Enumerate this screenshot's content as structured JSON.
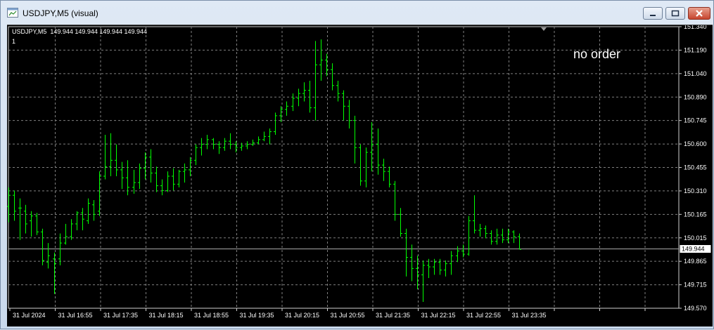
{
  "window": {
    "title": "USDJPY,M5 (visual)",
    "buttons": {
      "minimize_icon": "minimize-icon",
      "maximize_icon": "restore-icon",
      "close_icon": "close-icon"
    }
  },
  "chart_header": {
    "symbol_line": "USDJPY,M5  149.944 149.944 149.944 149.944",
    "sub_line": "1",
    "status_text": "no order"
  },
  "colors": {
    "background": "#000000",
    "grid": "#7f7f7f",
    "bars": "#00ff00",
    "text": "#ffffff",
    "price_line": "#c0c0c0"
  },
  "chart_data": {
    "type": "bar",
    "grid": true,
    "ylim": [
      149.57,
      151.34
    ],
    "y_ticks": [
      "151.340",
      "151.190",
      "151.040",
      "150.890",
      "150.745",
      "150.600",
      "150.455",
      "150.310",
      "150.165",
      "150.015",
      "149.865",
      "149.715",
      "149.570"
    ],
    "x_ticks": [
      "31 Jul 2024",
      "31 Jul 16:55",
      "31 Jul 17:35",
      "31 Jul 18:15",
      "31 Jul 18:55",
      "31 Jul 19:35",
      "31 Jul 20:15",
      "31 Jul 20:55",
      "31 Jul 21:35",
      "31 Jul 22:15",
      "31 Jul 22:55",
      "31 Jul 23:35"
    ],
    "current_price": "149.944",
    "bars": [
      {
        "o": 150.21,
        "h": 150.33,
        "l": 150.11,
        "c": 150.28
      },
      {
        "o": 150.28,
        "h": 150.31,
        "l": 150.12,
        "c": 150.18
      },
      {
        "o": 150.2,
        "h": 150.26,
        "l": 150.0,
        "c": 150.2
      },
      {
        "o": 150.18,
        "h": 150.22,
        "l": 150.04,
        "c": 150.1
      },
      {
        "o": 150.12,
        "h": 150.18,
        "l": 150.02,
        "c": 150.15
      },
      {
        "o": 150.15,
        "h": 150.17,
        "l": 150.03,
        "c": 150.05
      },
      {
        "o": 150.05,
        "h": 150.07,
        "l": 149.84,
        "c": 149.87
      },
      {
        "o": 149.86,
        "h": 149.98,
        "l": 149.82,
        "c": 149.9
      },
      {
        "o": 149.88,
        "h": 149.92,
        "l": 149.66,
        "c": 149.85
      },
      {
        "o": 149.88,
        "h": 150.04,
        "l": 149.84,
        "c": 149.98
      },
      {
        "o": 149.98,
        "h": 150.1,
        "l": 149.97,
        "c": 150.02
      },
      {
        "o": 150.02,
        "h": 150.13,
        "l": 150.0,
        "c": 150.1
      },
      {
        "o": 150.1,
        "h": 150.18,
        "l": 150.06,
        "c": 150.17
      },
      {
        "o": 150.17,
        "h": 150.2,
        "l": 150.06,
        "c": 150.13
      },
      {
        "o": 150.12,
        "h": 150.26,
        "l": 150.1,
        "c": 150.23
      },
      {
        "o": 150.22,
        "h": 150.25,
        "l": 150.12,
        "c": 150.16
      },
      {
        "o": 150.18,
        "h": 150.43,
        "l": 150.15,
        "c": 150.4
      },
      {
        "o": 150.4,
        "h": 150.66,
        "l": 150.38,
        "c": 150.46
      },
      {
        "o": 150.46,
        "h": 150.67,
        "l": 150.4,
        "c": 150.5
      },
      {
        "o": 150.5,
        "h": 150.6,
        "l": 150.4,
        "c": 150.44
      },
      {
        "o": 150.44,
        "h": 150.49,
        "l": 150.32,
        "c": 150.39
      },
      {
        "o": 150.39,
        "h": 150.5,
        "l": 150.28,
        "c": 150.33
      },
      {
        "o": 150.33,
        "h": 150.44,
        "l": 150.29,
        "c": 150.36
      },
      {
        "o": 150.36,
        "h": 150.48,
        "l": 150.32,
        "c": 150.45
      },
      {
        "o": 150.45,
        "h": 150.55,
        "l": 150.38,
        "c": 150.52
      },
      {
        "o": 150.52,
        "h": 150.57,
        "l": 150.36,
        "c": 150.42
      },
      {
        "o": 150.42,
        "h": 150.46,
        "l": 150.3,
        "c": 150.34
      },
      {
        "o": 150.34,
        "h": 150.38,
        "l": 150.28,
        "c": 150.31
      },
      {
        "o": 150.31,
        "h": 150.43,
        "l": 150.3,
        "c": 150.4
      },
      {
        "o": 150.4,
        "h": 150.45,
        "l": 150.31,
        "c": 150.35
      },
      {
        "o": 150.35,
        "h": 150.44,
        "l": 150.33,
        "c": 150.43
      },
      {
        "o": 150.43,
        "h": 150.48,
        "l": 150.36,
        "c": 150.44
      },
      {
        "o": 150.44,
        "h": 150.52,
        "l": 150.4,
        "c": 150.5
      },
      {
        "o": 150.5,
        "h": 150.6,
        "l": 150.47,
        "c": 150.58
      },
      {
        "o": 150.58,
        "h": 150.64,
        "l": 150.53,
        "c": 150.6
      },
      {
        "o": 150.6,
        "h": 150.66,
        "l": 150.57,
        "c": 150.63
      },
      {
        "o": 150.63,
        "h": 150.64,
        "l": 150.57,
        "c": 150.6
      },
      {
        "o": 150.6,
        "h": 150.62,
        "l": 150.54,
        "c": 150.58
      },
      {
        "o": 150.58,
        "h": 150.64,
        "l": 150.56,
        "c": 150.62
      },
      {
        "o": 150.62,
        "h": 150.67,
        "l": 150.57,
        "c": 150.6
      },
      {
        "o": 150.6,
        "h": 150.62,
        "l": 150.55,
        "c": 150.58
      },
      {
        "o": 150.58,
        "h": 150.61,
        "l": 150.56,
        "c": 150.59
      },
      {
        "o": 150.59,
        "h": 150.62,
        "l": 150.57,
        "c": 150.6
      },
      {
        "o": 150.6,
        "h": 150.63,
        "l": 150.59,
        "c": 150.61
      },
      {
        "o": 150.61,
        "h": 150.65,
        "l": 150.6,
        "c": 150.63
      },
      {
        "o": 150.63,
        "h": 150.68,
        "l": 150.62,
        "c": 150.65
      },
      {
        "o": 150.65,
        "h": 150.7,
        "l": 150.6,
        "c": 150.68
      },
      {
        "o": 150.68,
        "h": 150.8,
        "l": 150.66,
        "c": 150.78
      },
      {
        "o": 150.78,
        "h": 150.84,
        "l": 150.74,
        "c": 150.82
      },
      {
        "o": 150.82,
        "h": 150.87,
        "l": 150.78,
        "c": 150.84
      },
      {
        "o": 150.84,
        "h": 150.92,
        "l": 150.81,
        "c": 150.89
      },
      {
        "o": 150.89,
        "h": 150.95,
        "l": 150.84,
        "c": 150.92
      },
      {
        "o": 150.92,
        "h": 150.99,
        "l": 150.87,
        "c": 150.94
      },
      {
        "o": 150.94,
        "h": 151.0,
        "l": 150.8,
        "c": 150.83
      },
      {
        "o": 150.83,
        "h": 151.25,
        "l": 150.75,
        "c": 151.1
      },
      {
        "o": 151.1,
        "h": 151.26,
        "l": 151.0,
        "c": 151.13
      },
      {
        "o": 151.13,
        "h": 151.17,
        "l": 151.03,
        "c": 151.07
      },
      {
        "o": 151.07,
        "h": 151.11,
        "l": 150.94,
        "c": 150.97
      },
      {
        "o": 150.97,
        "h": 151.0,
        "l": 150.87,
        "c": 150.92
      },
      {
        "o": 150.92,
        "h": 150.94,
        "l": 150.75,
        "c": 150.84
      },
      {
        "o": 150.84,
        "h": 150.88,
        "l": 150.7,
        "c": 150.75
      },
      {
        "o": 150.75,
        "h": 150.78,
        "l": 150.48,
        "c": 150.58
      },
      {
        "o": 150.58,
        "h": 150.6,
        "l": 150.34,
        "c": 150.37
      },
      {
        "o": 150.37,
        "h": 150.58,
        "l": 150.33,
        "c": 150.55
      },
      {
        "o": 150.55,
        "h": 150.74,
        "l": 150.43,
        "c": 150.6
      },
      {
        "o": 150.6,
        "h": 150.7,
        "l": 150.41,
        "c": 150.47
      },
      {
        "o": 150.47,
        "h": 150.51,
        "l": 150.37,
        "c": 150.43
      },
      {
        "o": 150.43,
        "h": 150.46,
        "l": 150.33,
        "c": 150.35
      },
      {
        "o": 150.35,
        "h": 150.37,
        "l": 150.12,
        "c": 150.16
      },
      {
        "o": 150.16,
        "h": 150.2,
        "l": 150.02,
        "c": 150.04
      },
      {
        "o": 150.04,
        "h": 150.07,
        "l": 149.77,
        "c": 149.89
      },
      {
        "o": 149.89,
        "h": 149.97,
        "l": 149.74,
        "c": 149.82
      },
      {
        "o": 149.82,
        "h": 149.9,
        "l": 149.69,
        "c": 149.78
      },
      {
        "o": 149.78,
        "h": 149.87,
        "l": 149.61,
        "c": 149.84
      },
      {
        "o": 149.84,
        "h": 149.88,
        "l": 149.76,
        "c": 149.83
      },
      {
        "o": 149.83,
        "h": 149.88,
        "l": 149.78,
        "c": 149.86
      },
      {
        "o": 149.86,
        "h": 149.88,
        "l": 149.78,
        "c": 149.81
      },
      {
        "o": 149.81,
        "h": 149.87,
        "l": 149.77,
        "c": 149.85
      },
      {
        "o": 149.85,
        "h": 149.93,
        "l": 149.78,
        "c": 149.9
      },
      {
        "o": 149.9,
        "h": 149.96,
        "l": 149.86,
        "c": 149.93
      },
      {
        "o": 149.93,
        "h": 149.97,
        "l": 149.89,
        "c": 149.91
      },
      {
        "o": 149.91,
        "h": 150.15,
        "l": 149.9,
        "c": 150.12
      },
      {
        "o": 150.12,
        "h": 150.28,
        "l": 150.04,
        "c": 150.06
      },
      {
        "o": 150.06,
        "h": 150.1,
        "l": 150.02,
        "c": 150.07
      },
      {
        "o": 150.07,
        "h": 150.09,
        "l": 150.01,
        "c": 150.04
      },
      {
        "o": 150.04,
        "h": 150.06,
        "l": 149.97,
        "c": 149.99
      },
      {
        "o": 149.99,
        "h": 150.07,
        "l": 149.97,
        "c": 150.03
      },
      {
        "o": 150.03,
        "h": 150.07,
        "l": 149.98,
        "c": 150.0
      },
      {
        "o": 150.0,
        "h": 150.07,
        "l": 149.98,
        "c": 150.05
      },
      {
        "o": 150.05,
        "h": 150.06,
        "l": 149.98,
        "c": 150.02
      },
      {
        "o": 150.02,
        "h": 150.04,
        "l": 149.94,
        "c": 149.94
      }
    ]
  }
}
